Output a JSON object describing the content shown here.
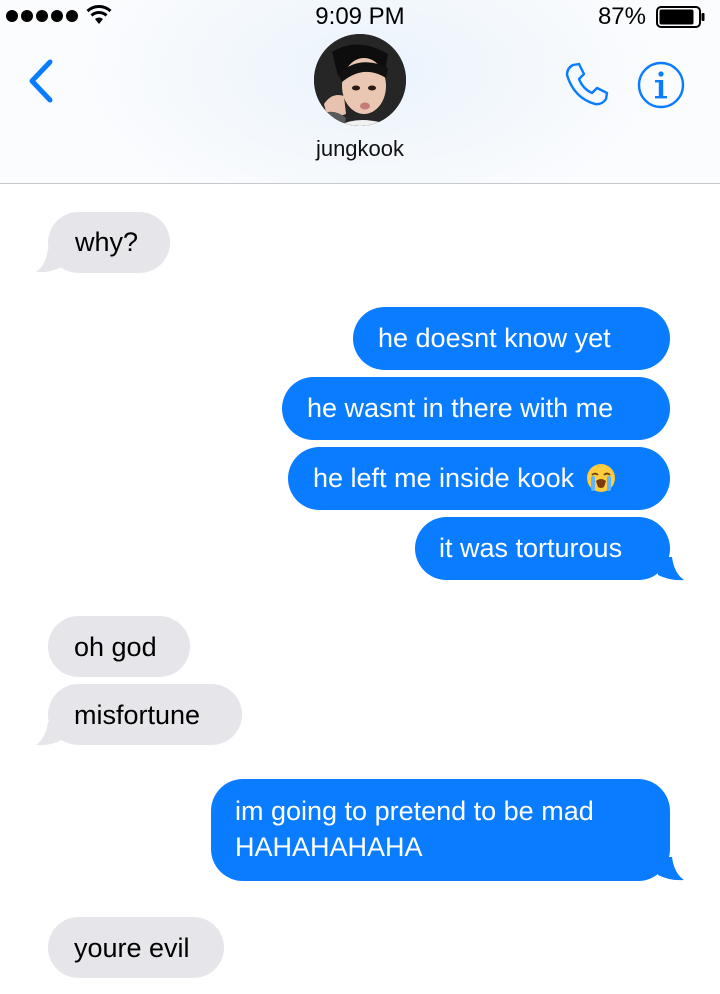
{
  "status_bar": {
    "time": "9:09 PM",
    "battery_percent": "87%",
    "signal_bars": 5,
    "wifi_icon": "wifi-icon",
    "battery_level": 0.87
  },
  "header": {
    "back_icon": "chevron-left-icon",
    "contact_name": "jungkook",
    "call_icon": "phone-icon",
    "info_icon": "info-icon"
  },
  "messages": [
    {
      "from": "them",
      "text": "why?"
    },
    {
      "from": "me",
      "text": "he doesnt know yet"
    },
    {
      "from": "me",
      "text": "he wasnt in there with me"
    },
    {
      "from": "me",
      "text": "he left me inside kook",
      "emoji": "loudly-crying-face-emoji"
    },
    {
      "from": "me",
      "text": "it was torturous"
    },
    {
      "from": "them",
      "text": "oh god"
    },
    {
      "from": "them",
      "text": "misfortune"
    },
    {
      "from": "me",
      "lines": [
        "im going to pretend to be mad",
        "HAHAHAHAHA"
      ]
    },
    {
      "from": "them",
      "text": "youre evil"
    }
  ],
  "colors": {
    "accent": "#0a7cff",
    "received_bubble": "#e5e5ea",
    "sent_bubble": "#0a7cff"
  }
}
